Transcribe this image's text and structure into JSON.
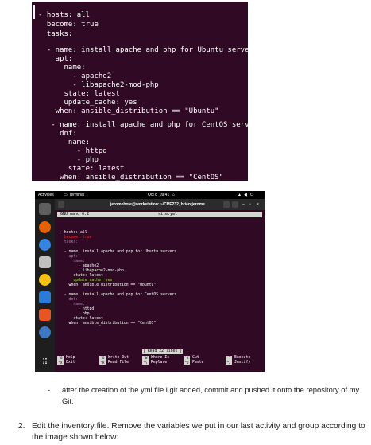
{
  "snippet": {
    "lines": [
      "- hosts: all",
      "  become: true",
      "  tasks:",
      "",
      "  - name: install apache and php for Ubuntu servers",
      "    apt:",
      "      name:",
      "        - apache2",
      "        - libapache2-mod-php",
      "      state: latest",
      "      update_cache: yes",
      "    when: ansible_distribution == \"Ubuntu\"",
      "",
      "   - name: install apache and php for CentOS servers",
      "     dnf:",
      "       name:",
      "         - httpd",
      "         - php",
      "       state: latest",
      "     when: ansible_distribution == \"CentOS\""
    ]
  },
  "screenshot": {
    "topbar": {
      "activities": "Activities",
      "app": "Terminal",
      "clock": "Oct 8  09:41"
    },
    "terminal_title": "jeromebote@workstation: ~/CPE232_briantjerome",
    "nano": {
      "version": "GNU nano 6.2",
      "file": "site.yml"
    },
    "lines": [
      "- hosts: all",
      "  become: true",
      "  tasks:",
      "",
      "  - name: install apache and php for Ubuntu servers",
      "    apt:",
      "      name:",
      "        - apache2",
      "        - libapache2-mod-php",
      "      state: latest",
      "      update_cache: yes",
      "    when: ansible_distribution == \"Ubuntu\"",
      "",
      "  - name: install apache and php for CentOS servers",
      "    dnf:",
      "      name:",
      "        - httpd",
      "        - php",
      "      state: latest",
      "    when: ansible_distribution == \"CentOS\""
    ],
    "status": "[ Read 22 lines ]",
    "shortcuts": [
      {
        "key": "^G",
        "label": "Help"
      },
      {
        "key": "^X",
        "label": "Exit"
      },
      {
        "key": "^O",
        "label": "Write Out"
      },
      {
        "key": "^R",
        "label": "Read File"
      },
      {
        "key": "^W",
        "label": "Where Is"
      },
      {
        "key": "^\\",
        "label": "Replace"
      },
      {
        "key": "^K",
        "label": "Cut"
      },
      {
        "key": "^U",
        "label": "Paste"
      },
      {
        "key": "^T",
        "label": "Execute"
      },
      {
        "key": "^J",
        "label": "Justify"
      }
    ]
  },
  "text": {
    "bullet_dash": "-",
    "bullet": "after the creation of the yml file i git added, commit and pushed it onto the repository of my Git.",
    "item_number": "2.",
    "item": "Edit the inventory file. Remove the variables we put in our last activity and group according to the image shown below:"
  }
}
